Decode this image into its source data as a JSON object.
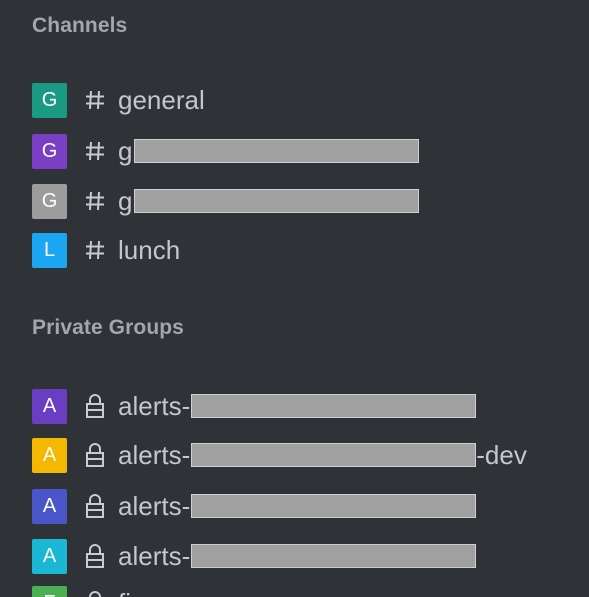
{
  "sections": {
    "channels_title": "Channels",
    "private_title": "Private Groups"
  },
  "channels": [
    {
      "letter": "G",
      "color": "#1a9a82",
      "name": "general",
      "redacted": false
    },
    {
      "letter": "G",
      "color": "#7a3fc4",
      "name": "g",
      "redacted": true
    },
    {
      "letter": "G",
      "color": "#9c9c9c",
      "name": "g",
      "redacted": true
    },
    {
      "letter": "L",
      "color": "#1aa6f0",
      "name": "lunch",
      "redacted": false
    }
  ],
  "groups": [
    {
      "letter": "A",
      "color": "#6a3ec2",
      "name": "alerts-",
      "suffix": "",
      "redacted": true
    },
    {
      "letter": "A",
      "color": "#f5b800",
      "name": "alerts-",
      "suffix": "-dev",
      "redacted": true
    },
    {
      "letter": "A",
      "color": "#4a55c9",
      "name": "alerts-",
      "suffix": "",
      "redacted": true
    },
    {
      "letter": "A",
      "color": "#1ab8d4",
      "name": "alerts-",
      "suffix": "",
      "redacted": true
    },
    {
      "letter": "F",
      "color": "#4caf50",
      "name": "fi",
      "suffix": "",
      "redacted": false
    }
  ]
}
